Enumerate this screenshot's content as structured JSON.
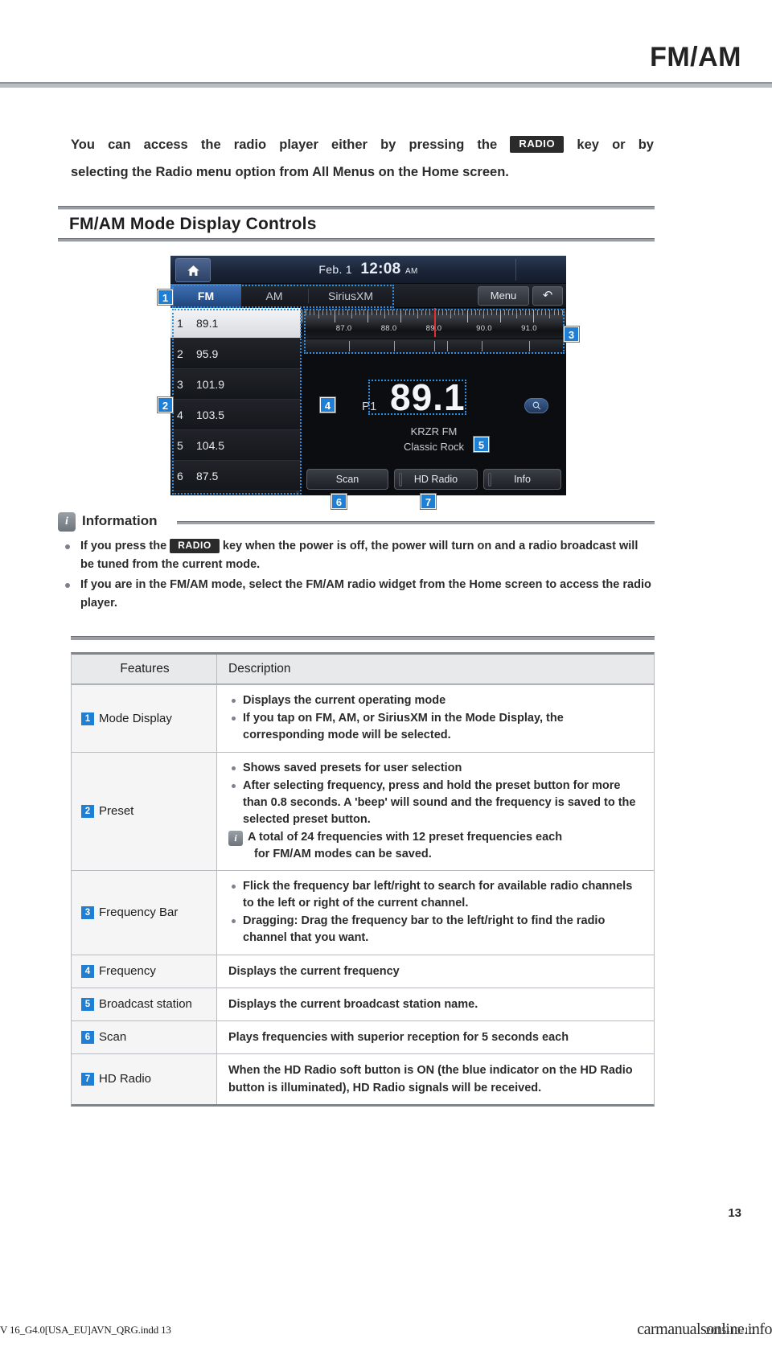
{
  "header": {
    "title": "FM/AM"
  },
  "intro": {
    "line1_before": "You  can  access  the  radio  player  either  by  pressing  the",
    "keycap": "RADIO",
    "line1_after": "key  or  by",
    "line2": "selecting the Radio menu option from All Menus on the Home screen."
  },
  "section": {
    "title": "FM/AM Mode Display Controls"
  },
  "device": {
    "status": {
      "date": "Feb.  1",
      "time": "12:08",
      "ampm": "AM",
      "home_icon": "home-icon"
    },
    "tabs": [
      {
        "label": "FM",
        "active": true
      },
      {
        "label": "AM",
        "active": false
      },
      {
        "label": "SiriusXM",
        "active": false
      }
    ],
    "menu_label": "Menu",
    "back_label": "↶",
    "presets": [
      {
        "index": "1",
        "freq": "89.1",
        "selected": true
      },
      {
        "index": "2",
        "freq": "95.9",
        "selected": false
      },
      {
        "index": "3",
        "freq": "101.9",
        "selected": false
      },
      {
        "index": "4",
        "freq": "103.5",
        "selected": false
      },
      {
        "index": "5",
        "freq": "104.5",
        "selected": false
      },
      {
        "index": "6",
        "freq": "87.5",
        "selected": false
      }
    ],
    "frequency_bar": {
      "labels": [
        "87.0",
        "88.0",
        "89.0",
        "90.0",
        "91.0"
      ],
      "needle_value": "89.1",
      "needle_color": "#e03030"
    },
    "tuner": {
      "preset_no": "P1",
      "frequency": "89.1",
      "station_name": "KRZR FM",
      "station_genre": "Classic Rock",
      "search_icon": "search-icon"
    },
    "soft_buttons": [
      {
        "label": "Scan",
        "has_led": false
      },
      {
        "label": "HD Radio",
        "has_led": true
      },
      {
        "label": "Info",
        "has_led": true
      }
    ],
    "callout_badges": [
      "1",
      "2",
      "3",
      "4",
      "5",
      "6",
      "7"
    ],
    "callout_color": "#2f8fe0"
  },
  "information": {
    "icon": "i",
    "title": "Information",
    "items": [
      {
        "before": "If you press the",
        "keycap": "RADIO",
        "after": "key when the power is off, the power will turn on and a radio broadcast will be tuned from the current mode."
      },
      {
        "text": "If you are in the FM/AM mode, select the FM/AM radio widget from the Home screen to access the radio player."
      }
    ]
  },
  "table": {
    "headers": {
      "features": "Features",
      "description": "Description"
    },
    "rows": [
      {
        "num": "1",
        "feature": "Mode Display",
        "bullets": [
          "Displays the current operating mode",
          "If you tap on FM, AM, or SiriusXM in the Mode Display, the corresponding mode will be selected."
        ]
      },
      {
        "num": "2",
        "feature": "Preset",
        "bullets": [
          "Shows saved presets for user selection",
          "After selecting frequency, press and hold the preset button for more than 0.8 seconds. A 'beep' will sound and the frequency is saved to the selected preset button."
        ],
        "note_line1": "A total of 24 frequencies with 12 preset frequencies each",
        "note_line2": "for FM/AM modes can be saved."
      },
      {
        "num": "3",
        "feature": "Frequency Bar",
        "bullets": [
          "Flick the frequency bar left/right to search for available radio channels to the left or right of the current channel.",
          "Dragging: Drag the frequency bar to the left/right to find the radio channel that you want."
        ]
      },
      {
        "num": "4",
        "feature": "Frequency",
        "plain": "Displays the current frequency"
      },
      {
        "num": "5",
        "feature": "Broadcast station",
        "plain": "Displays the current broadcast station name."
      },
      {
        "num": "6",
        "feature": "Scan",
        "plain": "Plays frequencies with superior reception for 5 seconds each"
      },
      {
        "num": "7",
        "feature": "HD Radio",
        "plain": "When the HD Radio soft button is ON (the blue indicator on the HD Radio button is illuminated), HD Radio signals will be received."
      }
    ]
  },
  "footer": {
    "page_number": "13",
    "left": "V 16_G4.0[USA_EU]AVN_QRG.indd   13",
    "right": "carmanualsonline.info",
    "date": "2015-10-10"
  }
}
